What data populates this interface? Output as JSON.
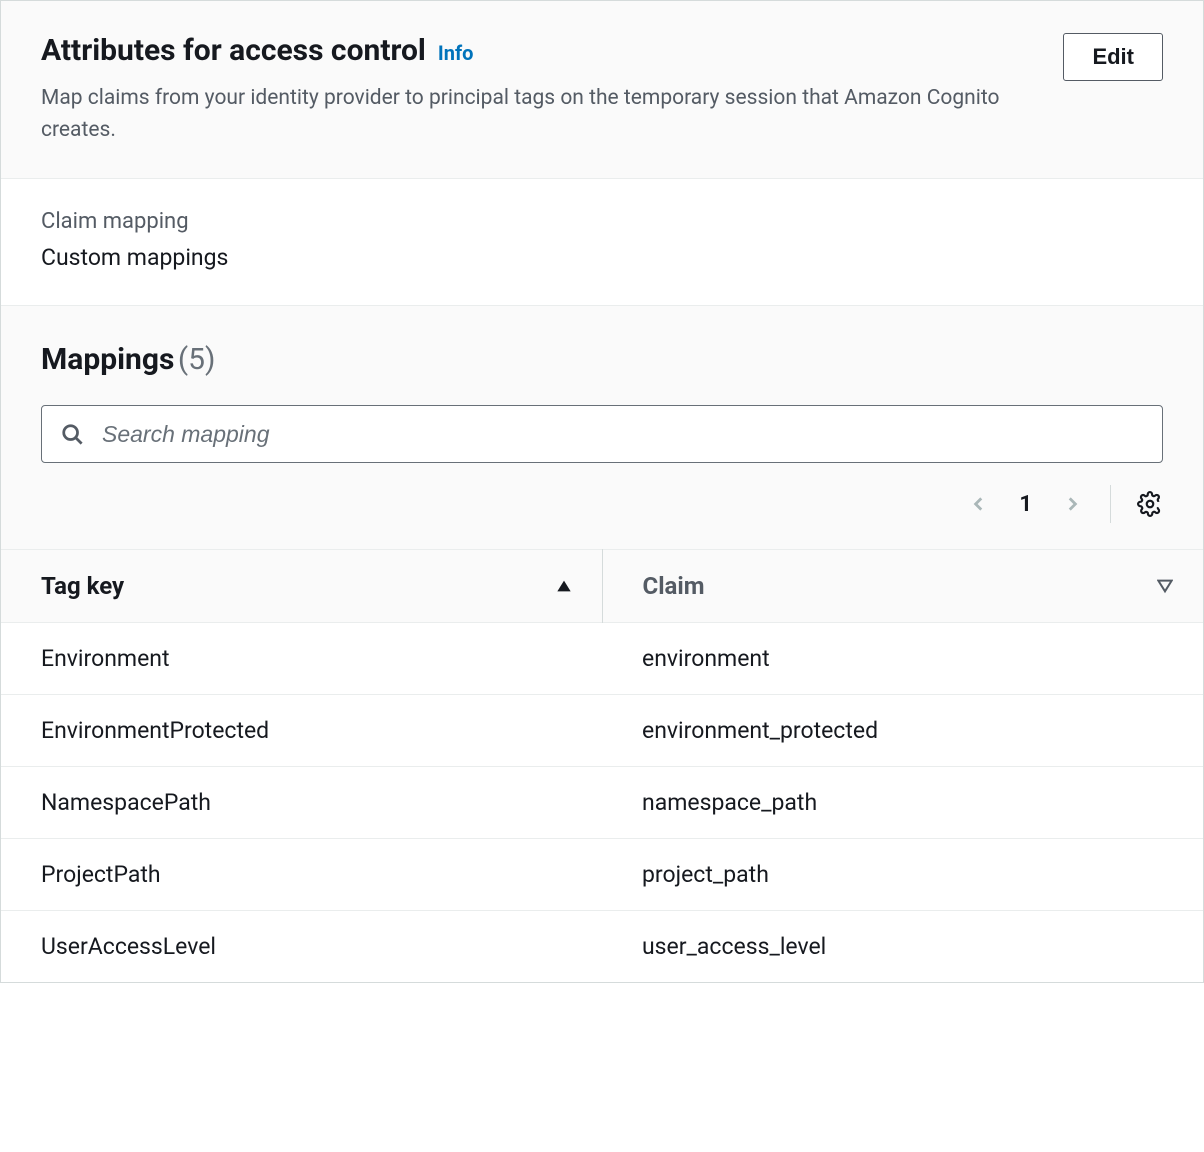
{
  "header": {
    "title": "Attributes for access control",
    "info_label": "Info",
    "description": "Map claims from your identity provider to principal tags on the temporary session that Amazon Cognito creates.",
    "edit_label": "Edit"
  },
  "claim": {
    "label": "Claim mapping",
    "value": "Custom mappings"
  },
  "mappings": {
    "title": "Mappings",
    "count": "(5)",
    "search_placeholder": "Search mapping",
    "page": "1",
    "columns": {
      "tag_key": "Tag key",
      "claim": "Claim"
    },
    "rows": [
      {
        "tag_key": "Environment",
        "claim": "environment"
      },
      {
        "tag_key": "EnvironmentProtected",
        "claim": "environment_protected"
      },
      {
        "tag_key": "NamespacePath",
        "claim": "namespace_path"
      },
      {
        "tag_key": "ProjectPath",
        "claim": "project_path"
      },
      {
        "tag_key": "UserAccessLevel",
        "claim": "user_access_level"
      }
    ]
  }
}
